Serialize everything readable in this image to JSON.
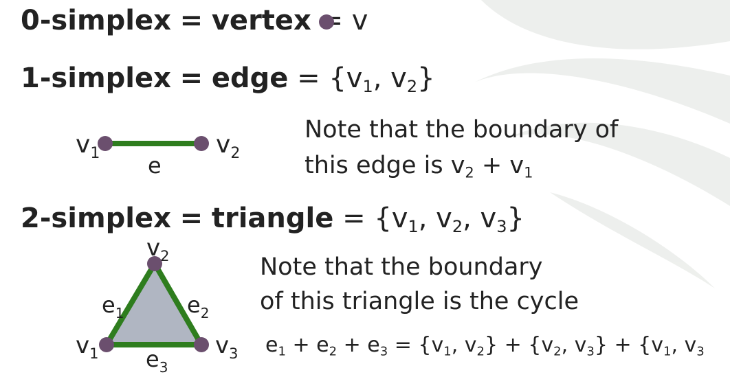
{
  "colors": {
    "vertex": "#6b4f6e",
    "edge": "#2e7d1e",
    "triangle_fill": "#b0b6c2",
    "text": "#222222"
  },
  "line0": {
    "term": "0-simplex",
    "eq1": "=",
    "name": "vertex",
    "eq2": "=",
    "value": "v"
  },
  "line1": {
    "term": "1-simplex",
    "eq1": "=",
    "name": "edge",
    "eq2": "=",
    "open": "{v",
    "sub1": "1",
    "mid": ", v",
    "sub2": "2",
    "close": "}"
  },
  "edge_diagram": {
    "v1": "v",
    "v1_sub": "1",
    "v2": "v",
    "v2_sub": "2",
    "edge": "e"
  },
  "note1": {
    "line1": "Note that the boundary of",
    "line2_a": "this edge is v",
    "line2_sub1": "2",
    "line2_b": " +  v",
    "line2_sub2": "1"
  },
  "line2": {
    "term": "2-simplex",
    "eq1": "=",
    "name": "triangle",
    "eq2": "=",
    "open": "{v",
    "sub1": "1",
    "m1": ", v",
    "sub2": "2",
    "m2": ", v",
    "sub3": "3",
    "close": "}"
  },
  "triangle_diagram": {
    "v1": "v",
    "v1_sub": "1",
    "v2": "v",
    "v2_sub": "2",
    "v3": "v",
    "v3_sub": "3",
    "e1": "e",
    "e1_sub": "1",
    "e2": "e",
    "e2_sub": "2",
    "e3": "e",
    "e3_sub": "3"
  },
  "note2": {
    "line1": "Note that the boundary",
    "line2": "of this triangle is the cycle"
  },
  "formula": {
    "p1": "e",
    "s1": "1",
    "p2": " + e",
    "s2": "2",
    "p3": " +  e",
    "s3": "3",
    "p4": " = {v",
    "s4": "1",
    "p5": ", v",
    "s5": "2",
    "p6": "} + {v",
    "s6": "2",
    "p7": ", v",
    "s7": "3",
    "p8": "} + {v",
    "s8": "1",
    "p9": ", v",
    "s9": "3"
  }
}
